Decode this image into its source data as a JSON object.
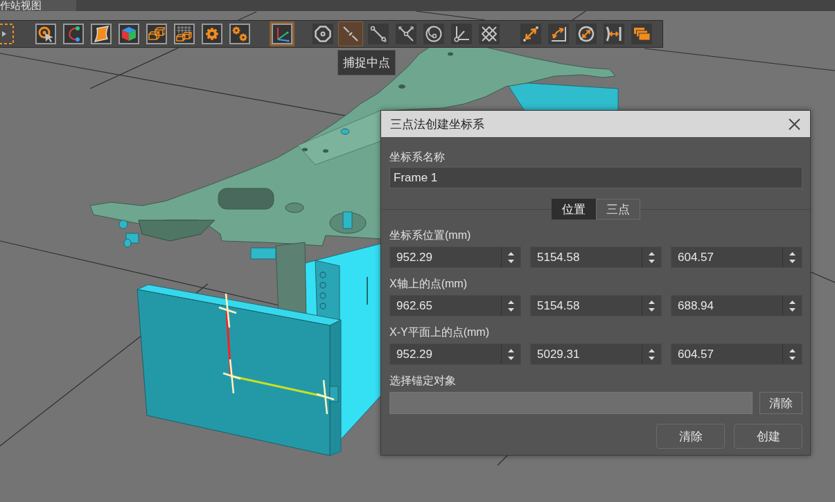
{
  "view_tab": {
    "label": "作站视图"
  },
  "toolbar": {
    "groups": [
      {
        "kind": "plain",
        "buttons": [
          {
            "selected": false
          }
        ]
      },
      {
        "kind": "framed",
        "buttons": [
          {
            "selected": false
          },
          {
            "selected": false
          },
          {
            "selected": false
          },
          {
            "selected": false
          },
          {
            "selected": false
          },
          {
            "selected": false
          },
          {
            "selected": false
          },
          {
            "selected": false
          }
        ]
      },
      {
        "kind": "framed",
        "buttons": [
          {
            "selected": true
          }
        ]
      },
      {
        "kind": "flat",
        "buttons": [
          {
            "selected": false
          },
          {
            "selected": true
          },
          {
            "selected": false
          },
          {
            "selected": false
          },
          {
            "selected": false
          },
          {
            "selected": false
          },
          {
            "selected": false
          }
        ]
      },
      {
        "kind": "flat",
        "buttons": [
          {
            "selected": false
          },
          {
            "selected": false
          },
          {
            "selected": false
          },
          {
            "selected": false
          },
          {
            "selected": false
          }
        ]
      }
    ]
  },
  "tooltip": {
    "text": "捕捉中点"
  },
  "dialog": {
    "title": "三点法创建坐标系",
    "name_field": {
      "label": "坐标系名称",
      "value": "Frame 1"
    },
    "tabs": [
      {
        "label": "位置",
        "selected": true
      },
      {
        "label": "三点",
        "selected": false
      }
    ],
    "point_groups": [
      {
        "label": "坐标系位置(mm)",
        "values": [
          "952.29",
          "5154.58",
          "604.57"
        ]
      },
      {
        "label": "X轴上的点(mm)",
        "values": [
          "962.65",
          "5154.58",
          "688.94"
        ]
      },
      {
        "label": "X-Y平面上的点(mm)",
        "values": [
          "952.29",
          "5029.31",
          "604.57"
        ]
      }
    ],
    "anchor": {
      "label": "选择锚定对象",
      "disabled": true,
      "button": "清除"
    },
    "buttons": [
      "清除",
      "创建"
    ]
  }
}
